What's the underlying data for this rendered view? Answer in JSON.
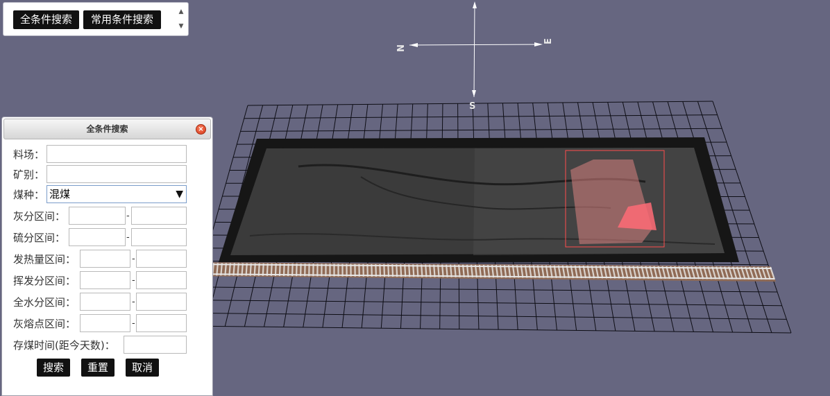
{
  "toolbar": {
    "all_search_label": "全条件搜索",
    "common_search_label": "常用条件搜索",
    "scroll_up": "▲",
    "scroll_down": "▼"
  },
  "compass": {
    "north": "N",
    "east": "E",
    "south": "S"
  },
  "dialog": {
    "title": "全条件搜索",
    "close": "×",
    "yard_label": "料场：",
    "mine_label": "矿别：",
    "coal_type_label": "煤种：",
    "coal_type_value": "混煤",
    "coal_type_caret": "▼",
    "ash_label": "灰分区间：",
    "sulfur_label": "硫分区间：",
    "heat_label": "发热量区间：",
    "volatile_label": "挥发分区间：",
    "moisture_label": "全水分区间：",
    "ash_fusion_label": "灰熔点区间：",
    "storage_time_label": "存煤时间(距今天数)：",
    "range_sep": "-",
    "search_button": "搜索",
    "reset_button": "重置",
    "cancel_button": "取消"
  },
  "colors": {
    "background": "#666680",
    "grid": "#0d0d14",
    "button_bg": "#111111",
    "selection_box": "#ff4c4c"
  }
}
